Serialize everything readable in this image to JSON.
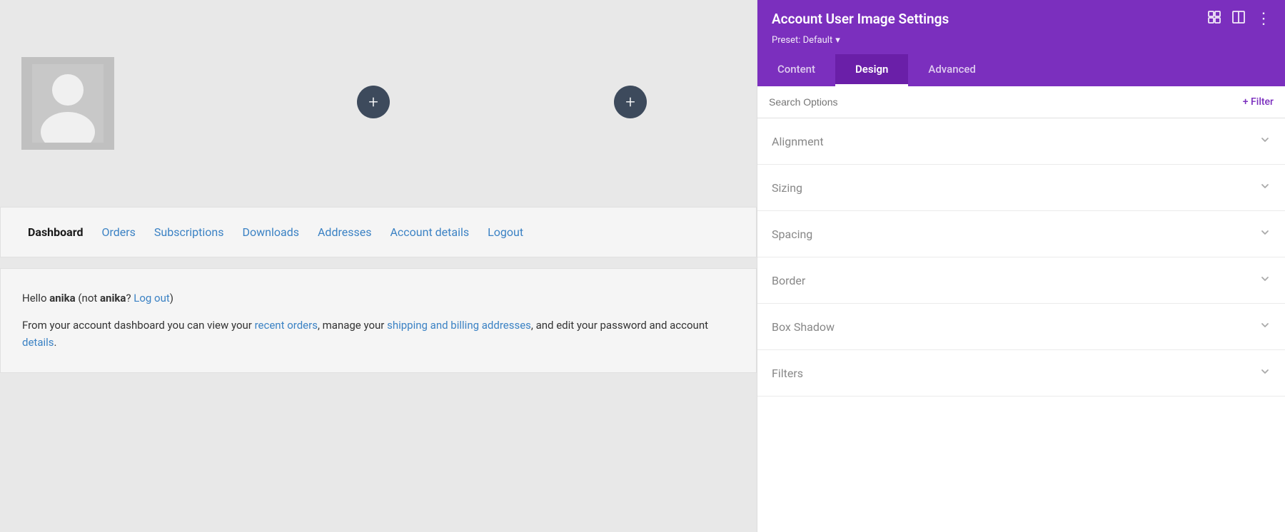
{
  "panel": {
    "title": "Account User Image Settings",
    "preset_label": "Preset: Default",
    "preset_arrow": "▾",
    "tabs": [
      {
        "id": "content",
        "label": "Content",
        "active": false
      },
      {
        "id": "design",
        "label": "Design",
        "active": true
      },
      {
        "id": "advanced",
        "label": "Advanced",
        "active": false
      }
    ],
    "search_placeholder": "Search Options",
    "filter_label": "+ Filter",
    "sections": [
      {
        "id": "alignment",
        "label": "Alignment"
      },
      {
        "id": "sizing",
        "label": "Sizing"
      },
      {
        "id": "spacing",
        "label": "Spacing"
      },
      {
        "id": "border",
        "label": "Border"
      },
      {
        "id": "box-shadow",
        "label": "Box Shadow"
      },
      {
        "id": "filters",
        "label": "Filters"
      }
    ]
  },
  "main": {
    "nav": {
      "items": [
        {
          "id": "dashboard",
          "label": "Dashboard",
          "active": true
        },
        {
          "id": "orders",
          "label": "Orders",
          "active": false
        },
        {
          "id": "subscriptions",
          "label": "Subscriptions",
          "active": false
        },
        {
          "id": "downloads",
          "label": "Downloads",
          "active": false
        },
        {
          "id": "addresses",
          "label": "Addresses",
          "active": false
        },
        {
          "id": "account-details",
          "label": "Account details",
          "active": false
        },
        {
          "id": "logout",
          "label": "Logout",
          "active": false
        }
      ]
    },
    "welcome": {
      "greeting": "Hello ",
      "username": "anika",
      "not_text": " (not ",
      "username2": "anika",
      "logout_text": "Log out",
      "close_paren": ")",
      "description_start": "From your account dashboard you can view your ",
      "recent_orders_link": "recent orders",
      "manage_text": ", manage your ",
      "billing_link": "shipping and billing addresses",
      "account_text": ", and edit your password and account details."
    },
    "add_button_1_label": "+",
    "add_button_2_label": "+"
  },
  "icons": {
    "chevron_down": "⌄",
    "maximize": "⛶",
    "split": "⊟",
    "more": "⋮",
    "plus": "+"
  }
}
